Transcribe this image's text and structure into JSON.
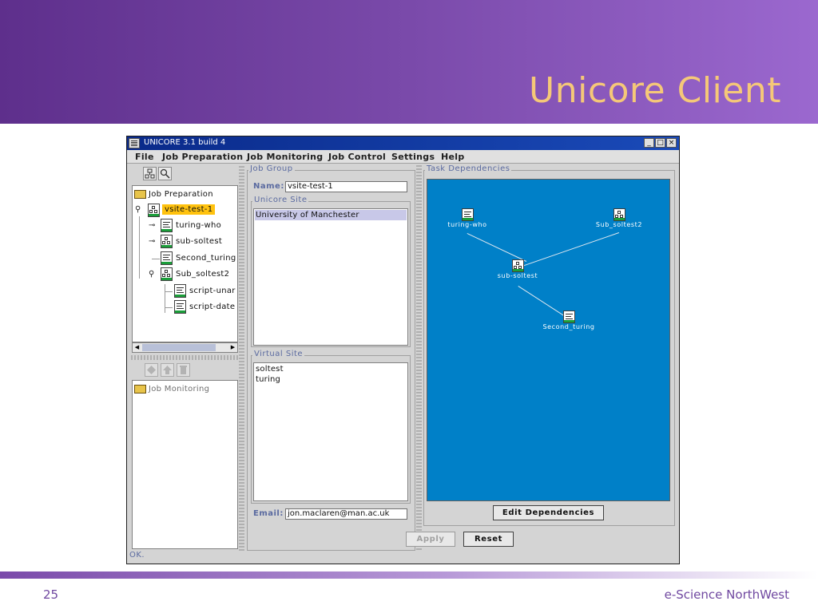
{
  "slide": {
    "title": "Unicore Client",
    "page_number": "25",
    "organization": "e-Science NorthWest"
  },
  "window": {
    "title": "UNICORE 3.1 build 4",
    "minimize_label": "_",
    "maximize_label": "□",
    "close_label": "×"
  },
  "menubar": {
    "items": [
      "File",
      "Job Preparation",
      "Job Monitoring",
      "Job Control",
      "Settings",
      "Help"
    ]
  },
  "tree": {
    "root": "Job Preparation",
    "items": [
      "vsite-test-1",
      "turing-who",
      "sub-soltest",
      "Second_turing",
      "Sub_soltest2",
      "script-unar",
      "script-date"
    ]
  },
  "monitor": {
    "root": "Job Monitoring"
  },
  "job_group": {
    "legend": "Job Group",
    "name_label": "Name:",
    "name_value": "vsite-test-1",
    "unicore_site_legend": "Unicore Site",
    "unicore_sites": [
      "University of Manchester"
    ],
    "virtual_site_legend": "Virtual Site",
    "virtual_sites": [
      "soltest",
      "turing"
    ],
    "email_label": "Email:",
    "email_value": "jon.maclaren@man.ac.uk"
  },
  "task_dependencies": {
    "legend": "Task Dependencies",
    "nodes": [
      "turing-who",
      "Sub_soltest2",
      "sub-soltest",
      "Second_turing"
    ],
    "edit_button": "Edit Dependencies"
  },
  "buttons": {
    "apply": "Apply",
    "reset": "Reset"
  },
  "status": "OK.",
  "colors": {
    "selection_highlight": "#ffc20e",
    "canvas_bg": "#0080c8",
    "title_text": "#f5c878"
  }
}
